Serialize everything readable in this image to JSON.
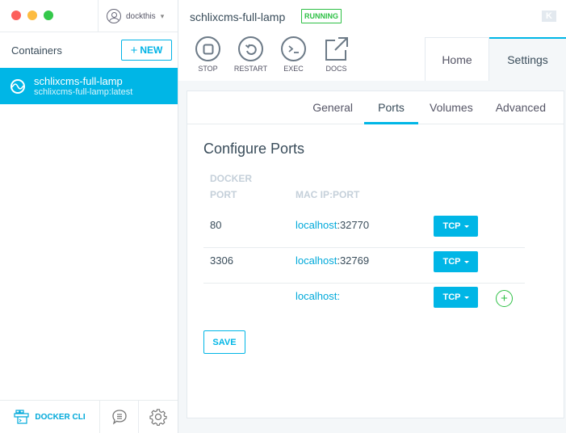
{
  "window": {
    "traffic_lights": {
      "close": "#fc605b",
      "minimize": "#fdbc40",
      "maximize": "#34c84a"
    },
    "user": {
      "name": "dockthis",
      "icon": "user-icon",
      "caret": "▾"
    }
  },
  "sidebar": {
    "title": "Containers",
    "new_button": {
      "plus": "+",
      "label": "NEW"
    },
    "containers": [
      {
        "name": "schlixcms-full-lamp",
        "image": "schlixcms-full-lamp:latest",
        "selected": true
      }
    ],
    "footer": {
      "docker_cli_label": "DOCKER CLI",
      "chat_icon": "chat-icon",
      "settings_icon": "gear-icon"
    }
  },
  "header": {
    "container_name": "schlixcms-full-lamp",
    "status": "RUNNING",
    "actions": [
      {
        "label": "STOP",
        "icon": "stop-icon"
      },
      {
        "label": "RESTART",
        "icon": "restart-icon"
      },
      {
        "label": "EXEC",
        "icon": "terminal-icon"
      },
      {
        "label": "DOCS",
        "icon": "external-link-icon"
      }
    ],
    "logo": "K",
    "tabs": [
      {
        "label": "Home",
        "active": false
      },
      {
        "label": "Settings",
        "active": true
      }
    ]
  },
  "settings": {
    "subtabs": [
      {
        "label": "General",
        "active": false
      },
      {
        "label": "Ports",
        "active": true
      },
      {
        "label": "Volumes",
        "active": false
      },
      {
        "label": "Advanced",
        "active": false
      }
    ],
    "title": "Configure Ports",
    "columns": {
      "docker_port_line1": "DOCKER",
      "docker_port_line2": "PORT",
      "mac_ip_port": "MAC IP:PORT"
    },
    "ports": [
      {
        "docker_port": "80",
        "host": "localhost",
        "sep": ":",
        "mac_port": "32770",
        "protocol": "TCP"
      },
      {
        "docker_port": "3306",
        "host": "localhost",
        "sep": ":",
        "mac_port": "32769",
        "protocol": "TCP"
      },
      {
        "docker_port": "",
        "host": "localhost",
        "sep": ":",
        "mac_port": "",
        "protocol": "TCP"
      }
    ],
    "add_symbol": "+",
    "save_label": "SAVE"
  },
  "colors": {
    "accent": "#00b6e6",
    "running": "#2ec045"
  }
}
